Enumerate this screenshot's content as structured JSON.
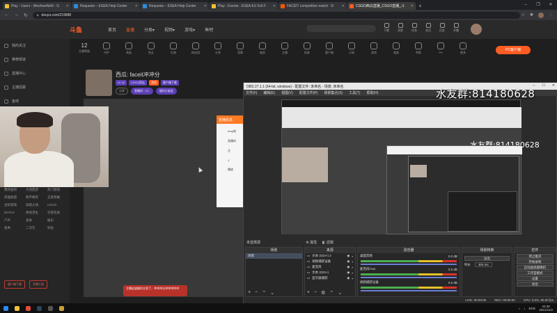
{
  "browser": {
    "tabs": [
      {
        "title": "Play - Users - WeshowNeN - G",
        "color": "#f0c030"
      },
      {
        "title": "Requests – ESEA Help Center",
        "color": "#2f8bd8"
      },
      {
        "title": "Requests – ESEA Help Center",
        "color": "#2f8bd8"
      },
      {
        "title": "Play - Events - ESEA EU 5v5 F",
        "color": "#f0c030"
      },
      {
        "title": "FACEIT competitive match - D",
        "color": "#ff5500"
      },
      {
        "title": "CSGO西瓜直播_CSGO直播_斗",
        "color": "#ff5d23"
      }
    ],
    "new_tab": "+",
    "url": "douyu.com/219688",
    "win_controls": [
      "–",
      "❐",
      "✕"
    ],
    "nav_icons": [
      "←",
      "→",
      "↻"
    ]
  },
  "douyu": {
    "logo": "斗鱼",
    "nav": [
      "首页",
      "直播",
      "分类▾",
      "视频▾",
      "游戏▾",
      "鱼吧"
    ],
    "nav_active_index": 1,
    "top_icons": [
      "下载",
      "消息",
      "任务",
      "关注",
      "历史",
      "开播"
    ],
    "categories": [
      {
        "num": "12",
        "label": "主播等级"
      },
      {
        "label": "守护"
      },
      {
        "label": "贵族"
      },
      {
        "label": "鱼丸"
      },
      {
        "label": "礼物"
      },
      {
        "label": "粉丝团"
      },
      {
        "label": "分享"
      },
      {
        "label": "竞猜"
      },
      {
        "label": "抽奖"
      },
      {
        "label": "主播"
      },
      {
        "label": "投屏"
      },
      {
        "label": "客户端"
      },
      {
        "label": "订阅"
      },
      {
        "label": "游戏"
      },
      {
        "label": "道具"
      },
      {
        "label": "举报"
      },
      {
        "label": "PK"
      },
      {
        "label": "更多"
      }
    ],
    "pc_client_button": "PC客户端",
    "streamer": {
      "name": "西瓜: faceit冲冲分",
      "tags": [
        "LV 12",
        "CSGO西瓜",
        "游戏",
        "客户端下载"
      ],
      "meta": [
        "分享",
        "直播间 · 0人",
        "福利大放送"
      ]
    },
    "popup": {
      "header": "直播信息",
      "lines": [
        "rtmp地",
        "直播码",
        "注",
        "1.",
        "播放"
      ]
    },
    "sidebar": [
      "我的关注",
      "推荐频道",
      "直播中心",
      "主播招募",
      "鱼吧",
      "游戏中心",
      "视频中心",
      "客服中心"
    ],
    "sidebar_lower": [
      "我的鱼吧",
      "大话西游",
      "热门游戏",
      "英雄联盟",
      "和平精英",
      "王者荣耀",
      "主机游戏",
      "穿越火线",
      "CSGO",
      "DOTA2",
      "绝地求生",
      "守望先锋",
      "户外",
      "美食",
      "娱乐",
      "星秀",
      "二次元",
      "科技"
    ],
    "sidebar_chips": [
      "客户端下载",
      "开播工具"
    ],
    "danmaku": "主播这波操作太秀了，冲冲冲分冲冲冲冲冲"
  },
  "obs": {
    "title": "OBS 27.1.1 (64-bit, windows) - 配置文件: 未命名 - 场景: 未命名",
    "menu": [
      "文件(F)",
      "编辑(E)",
      "视图(V)",
      "配置文件(P)",
      "场景集合(S)",
      "工具(T)",
      "帮助(H)"
    ],
    "source_status": "未选择源",
    "source_buttons": [
      "属性",
      "滤镜"
    ],
    "docks": {
      "scenes": {
        "title": "场景",
        "items": [
          "场景"
        ]
      },
      "sources": {
        "title": "来源",
        "items": [
          "文本 (GDI+) 2",
          "视频捕获设备",
          "麦克风",
          "文本 (GDI+)",
          "显示器捕获"
        ]
      },
      "mixer": {
        "title": "混音器",
        "channels": [
          {
            "name": "桌面音频",
            "level": "0.0 dB"
          },
          {
            "name": "麦克风/Aux",
            "level": "0.0 dB"
          },
          {
            "name": "视频捕获设备",
            "level": "0.0 dB"
          }
        ]
      },
      "transitions": {
        "title": "场景转换",
        "type": "淡出",
        "duration_label": "时长",
        "duration": "300 ms"
      },
      "controls": {
        "title": "控件",
        "buttons": [
          "停止推流",
          "开始录制",
          "启动虚拟摄像机",
          "工作室模式",
          "设置",
          "退出"
        ]
      }
    },
    "statusbar": [
      "LIVE: 00:00:00",
      "REC: 00:00:00",
      "CPU: 0.0%, 60.00 fps"
    ]
  },
  "watermark": "水友群:814180628",
  "watermark_nested": "水友群:814180628",
  "taskbar": {
    "apps": [
      {
        "name": "start",
        "color": "#2d89ef"
      },
      {
        "name": "folder",
        "color": "#f2c23c"
      },
      {
        "name": "chrome",
        "color": "#e34c3c"
      },
      {
        "name": "steam",
        "color": "#2a475e"
      },
      {
        "name": "obs",
        "color": "#555555"
      },
      {
        "name": "csgo",
        "color": "#c9a23a"
      }
    ],
    "lang": "ENG",
    "time": "22:38",
    "date": "2021/11/2"
  }
}
